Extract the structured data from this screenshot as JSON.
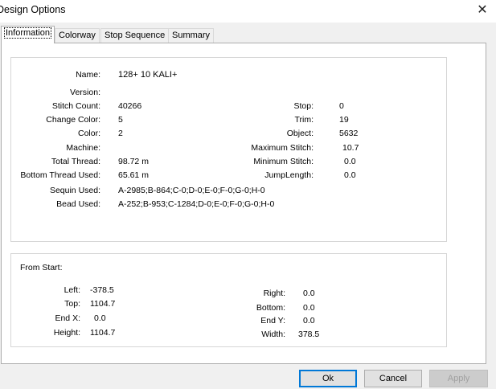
{
  "window": {
    "title": "Design Options",
    "close_glyph": "✕"
  },
  "tabs": [
    "Information",
    "Colorway",
    "Stop Sequence",
    "Summary"
  ],
  "info": {
    "name_label": "Name:",
    "name_value": "128+ 10 KALI+",
    "version_label": "Version:",
    "version_value": "",
    "stitch_count_label": "Stitch Count:",
    "stitch_count_value": "40266",
    "change_color_label": "Change Color:",
    "change_color_value": "5",
    "color_label": "Color:",
    "color_value": "2",
    "machine_label": "Machine:",
    "machine_value": "",
    "total_thread_label": "Total Thread:",
    "total_thread_value": "98.72 m",
    "bottom_thread_label": "Bottom Thread Used:",
    "bottom_thread_value": "65.61 m",
    "sequin_label": "Sequin Used:",
    "sequin_value": "A-2985;B-864;C-0;D-0;E-0;F-0;G-0;H-0",
    "bead_label": "Bead Used:",
    "bead_value": "A-252;B-953;C-1284;D-0;E-0;F-0;G-0;H-0",
    "stop_label": "Stop:",
    "stop_value": "0",
    "trim_label": "Trim:",
    "trim_value": "19",
    "object_label": "Object:",
    "object_value": "5632",
    "max_stitch_label": "Maximum Stitch:",
    "max_stitch_value": "10.7",
    "min_stitch_label": "Minimum Stitch:",
    "min_stitch_value": "0.0",
    "jump_length_label": "JumpLength:",
    "jump_length_value": "0.0"
  },
  "from_start": {
    "heading": "From Start:",
    "left_label": "Left:",
    "left_value": "-378.5",
    "top_label": "Top:",
    "top_value": "1104.7",
    "endx_label": "End X:",
    "endx_value": "0.0",
    "height_label": "Height:",
    "height_value": "1104.7",
    "right_label": "Right:",
    "right_value": "0.0",
    "bottom_label": "Bottom:",
    "bottom_value": "0.0",
    "endy_label": "End Y:",
    "endy_value": "0.0",
    "width_label": "Width:",
    "width_value": "378.5"
  },
  "buttons": {
    "ok": "Ok",
    "cancel": "Cancel",
    "apply": "Apply"
  }
}
